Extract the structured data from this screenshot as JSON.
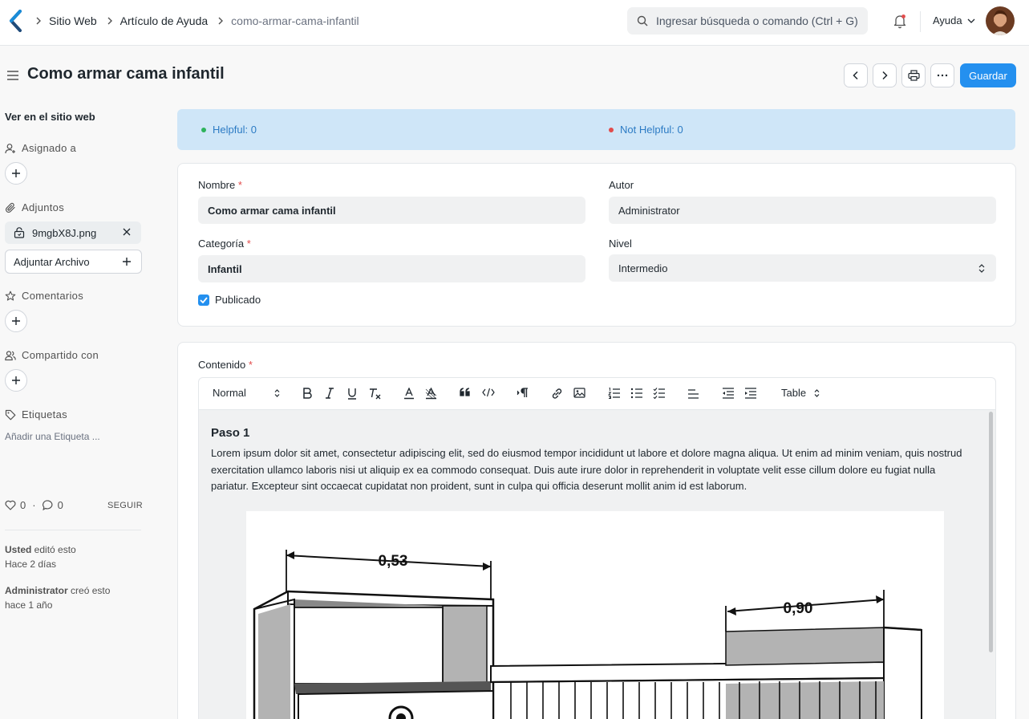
{
  "navbar": {
    "breadcrumbs": [
      "Sitio Web",
      "Artículo de Ayuda",
      "como-armar-cama-infantil"
    ],
    "search_placeholder": "Ingresar búsqueda o comando (Ctrl + G)",
    "help_label": "Ayuda"
  },
  "page": {
    "title": "Como armar cama infantil",
    "save_label": "Guardar"
  },
  "sidebar": {
    "view_website": "Ver en el sitio web",
    "assigned_label": "Asignado a",
    "attachments_label": "Adjuntos",
    "attachment_file": "9mgbX8J.png",
    "attach_button": "Adjuntar Archivo",
    "comments_label": "Comentarios",
    "shared_label": "Compartido con",
    "tags_label": "Etiquetas",
    "add_tag": "Añadir una Etiqueta ...",
    "likes_count": "0",
    "dot_separator": "·",
    "comments_count": "0",
    "follow_label": "SEGUIR",
    "activity": [
      {
        "actor": "Usted",
        "action": " editó esto",
        "time": "Hace 2 días"
      },
      {
        "actor": "Administrator",
        "action": " creó esto",
        "time": "hace 1 año"
      }
    ]
  },
  "stats": {
    "helpful": "Helpful: 0",
    "not_helpful": "Not Helpful: 0",
    "helpful_color": "#2eb35c",
    "not_helpful_color": "#e24c4c"
  },
  "form": {
    "name_label": "Nombre",
    "name_value": "Como armar cama infantil",
    "author_label": "Autor",
    "author_value": "Administrator",
    "category_label": "Categoría",
    "category_value": "Infantil",
    "level_label": "Nivel",
    "level_value": "Intermedio",
    "published_label": "Publicado",
    "required_mark": "*"
  },
  "editor": {
    "content_label": "Contenido",
    "format_select": "Normal",
    "table_select": "Table",
    "heading": "Paso 1",
    "paragraph": "Lorem ipsum dolor sit amet, consectetur adipiscing elit, sed do eiusmod tempor incididunt ut labore et dolore magna aliqua. Ut enim ad minim veniam, quis nostrud exercitation ullamco laboris nisi ut aliquip ex ea commodo consequat. Duis aute irure dolor in reprehenderit in voluptate velit esse cillum dolore eu fugiat nulla pariatur. Excepteur sint occaecat cupidatat non proident, sunt in culpa qui officia deserunt mollit anim id est laborum.",
    "image_dim_1": "0,53",
    "image_dim_2": "0,90"
  },
  "colors": {
    "accent": "#2490ef",
    "banner_bg": "#cfe6f8"
  }
}
